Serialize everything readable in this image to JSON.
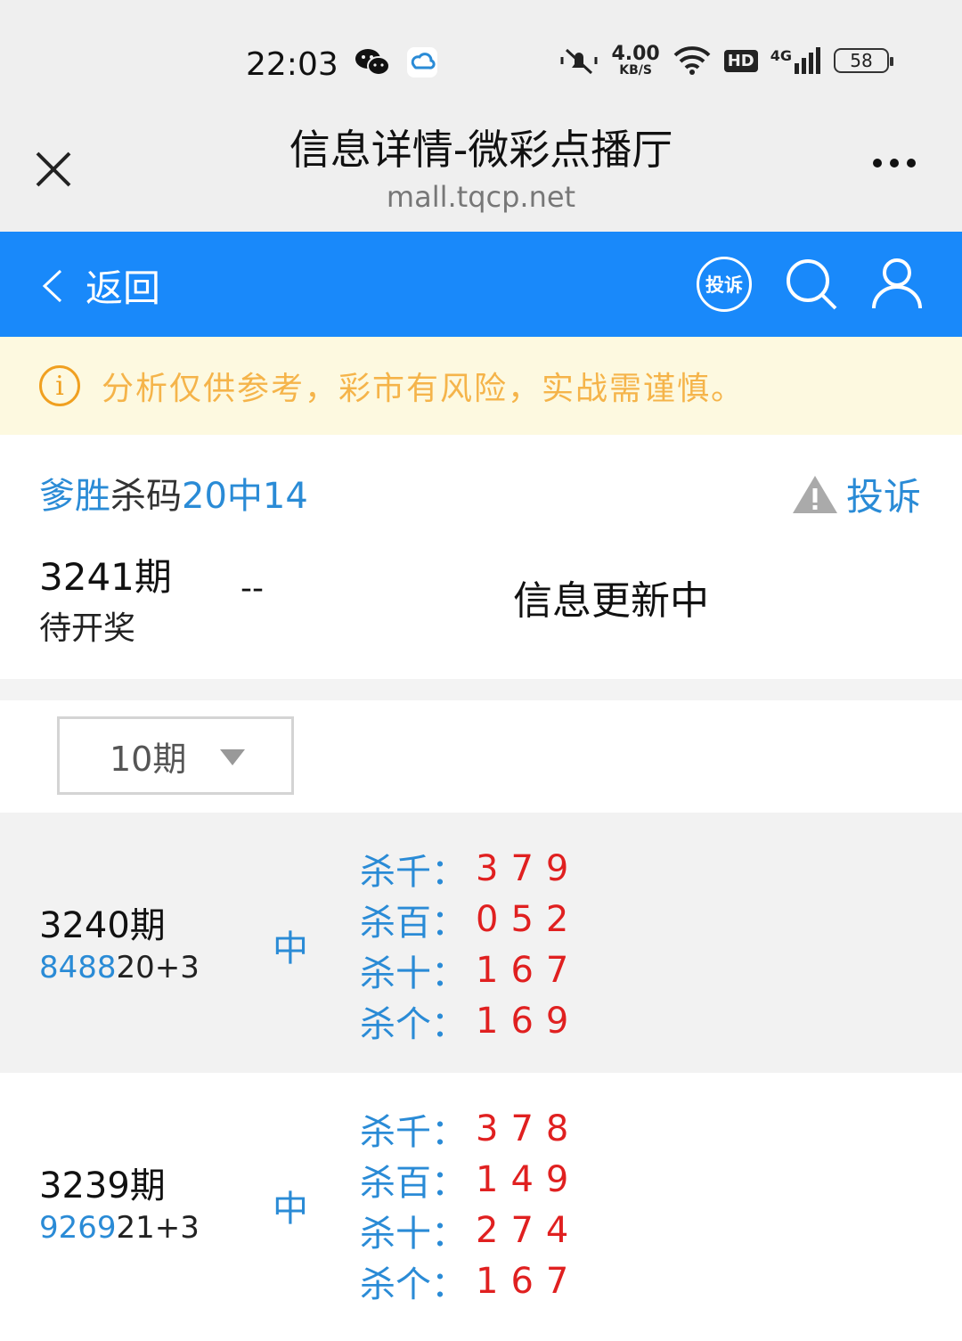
{
  "status_bar": {
    "time": "22:03",
    "net_speed": "4.00",
    "net_unit": "KB/S",
    "hd": "HD",
    "network": "4G",
    "battery": "58"
  },
  "titlebar": {
    "title": "信息详情-微彩点播厅",
    "url": "mall.tqcp.net"
  },
  "navbar": {
    "back_label": "返回",
    "complain_badge": "投诉"
  },
  "notice": {
    "text": "分析仅供参考，彩市有风险，实战需谨慎。"
  },
  "summary": {
    "name": "爹胜",
    "type": "杀码",
    "record": "20中14",
    "report_label": "投诉",
    "current_issue": "3241期",
    "current_status": "待开奖",
    "current_dash": "--",
    "current_update": "信息更新中"
  },
  "filter": {
    "selected": "10期"
  },
  "records": [
    {
      "issue": "3240期",
      "nums_highlight": "8488",
      "nums_rest": "20+3",
      "result": "中",
      "kills": [
        {
          "label": "杀千：",
          "values": "379"
        },
        {
          "label": "杀百：",
          "values": "052"
        },
        {
          "label": "杀十：",
          "values": "167"
        },
        {
          "label": "杀个：",
          "values": "169"
        }
      ]
    },
    {
      "issue": "3239期",
      "nums_highlight": "9269",
      "nums_rest": "21+3",
      "result": "中",
      "kills": [
        {
          "label": "杀千：",
          "values": "378"
        },
        {
          "label": "杀百：",
          "values": "149"
        },
        {
          "label": "杀十：",
          "values": "274"
        },
        {
          "label": "杀个：",
          "values": "167"
        }
      ]
    }
  ],
  "colors": {
    "accent": "#1989fa",
    "link_blue": "#2a8bd6",
    "kill_red": "#e02020",
    "notice_bg": "#fdf9e0",
    "notice_text": "#f5b44a"
  }
}
